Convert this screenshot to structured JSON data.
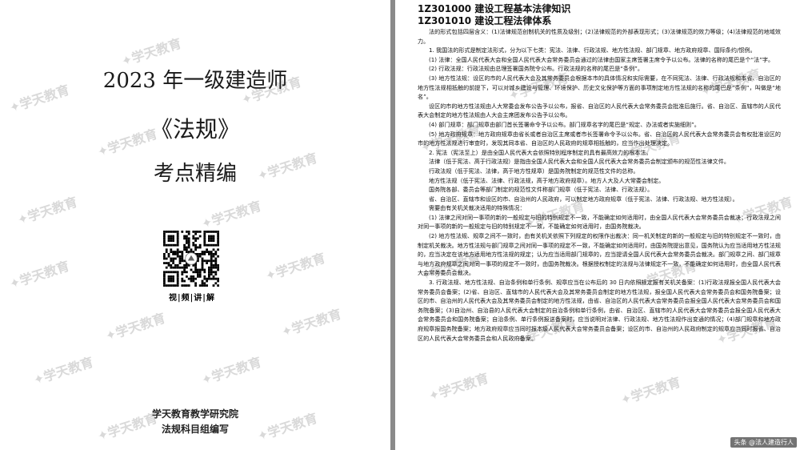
{
  "cover": {
    "title": "2023 年一级建造师",
    "subject": "《法规》",
    "subtitle": "考点精编",
    "video_label": "视|频|讲|解",
    "publisher": "学天教育教学研究院",
    "editor": "法规科目组编写"
  },
  "watermark": "学天教育",
  "corner_tag": "头条 @法人建造行人",
  "doc": {
    "chapter": "1Z301000 建设工程基本法律知识",
    "section": "1Z301010 建设工程法律体系",
    "paragraphs": [
      "法的形式包括四层含义：(1)法律规范创制机关的性质及级别；(2)法律规范的外部表现形式；(3)法律规范的效力等级；(4)法律规范的地域效力。",
      "1. 我国法的形式是制定法形式，分为以下七类：宪法、法律、行政法规、地方性法规、部门规章、地方政府规章、国际条约/惯例。",
      "(1) 法律：全国人民代表大会和全国人民代表大会常务委员会通过的法律由国家主席签署主席令予以公布。法律的名称的尾巴是个“法”字。",
      "(2) 行政法规：行政法规由总理签署国务院令公布。行政法规的名称的尾巴是“条例”。",
      "(3) 地方性法规：设区的市的人民代表大会及其常务委员会根据本市的具体情况和实际需要，在不同宪法、法律、行政法规和本省、自治区的地方性法规相抵触的前提下，可以对城乡建设与管理、环境保护、历史文化保护等方面的事项制定地方性法规的名称的尾巴是“条例”，叫做是“地名”。",
      "设区的市的地方性法规由人大常委会发布公告予以公布，报省、自治区的人民代表大会常务委员会批准后施行。省、自治区、直辖市的人民代表大会制定的地方性法规由人大会主席团发布公告予以公布。",
      "(4) 部门规章：部门规章由部门首长签署命令予以公布。部门规章名字的尾巴是“规定、办法或者实施细则”。",
      "(5) 地方政府规章：地方政府规章由省长或者自治区主席或者市长签署命令予以公布。省、自治区的人民代表大会常务委员会有权批准设区的市的地方性法规进行审查时，发现其同本省、自治区的人民政府的规章相抵触的，应当作出处理决定。",
      "2. 宪法（宪法至上）是由全国人民代表大会依照特别程序制定的具有最高效力的根本法。",
      "法律（低于宪法、高于行政法规）是指由全国人民代表大会和全国人民代表大会常务委员会制定颁布的规范性法律文件。",
      "行政法规（低于宪法、法律，高于地方性规章）是国务院制定的规范性文件的总称。",
      "地方性法规（低于宪法、法律、行政法规，高于地方政府规章）。地方人大及人大常委会制定。",
      "国务院各部、委员会等部门制定的规范性文件称部门规章（低于宪法、法律、行政法规）。",
      "省、自治区、直辖市和设区的市、自治州的人民政府，可以制定地方政府规章（低于宪法、法律、行政法规、地方性法规）。",
      "需要由有关机关裁决适用的特殊情况：",
      "(1) 法律之间对同一事项的新的一般规定与旧的特别规定不一致，不能确定如何适用时，由全国人民代表大会常务委员会裁决；行政法规之间对同一事项的新的一般规定与旧的特别规定不一致，不能确定如何适用时，由国务院裁决。",
      "(2) 地方性法规、规章之间不一致时，由有关机关依照下列规定的权限作出裁决：同一机关制定的新的一般规定与旧的特别规定不一致时，由制定机关裁决。地方性法规与部门规章之间对同一事项的规定不一致，不能确定如何适用时，由国务院提出意见，国务院认为应当适用地方性法规的，应当决定在该地方适用地方性法规的规定；认为应当适用部门规章的，应当提请全国人民代表大会常务委员会裁决。部门规章之间、部门规章与地方政府规章之间对同一事项的规定不一致时，由国务院裁决。根据授权制定的法规与法律规定不一致，不能确定如何适用时，由全国人民代表大会常务委员会裁决。",
      "3. 行政法规、地方性法规、自治条例和单行条例、规章应当在公布后的 30 日内依照规定报有关机关备案：(1)行政法规报全国人民代表大会常务委员会备案；(2)省、自治区、直辖市的人民代表大会及其常务委员会制定的地方性法规，报全国人民代表大会常务委员会和国务院备案；设区的市、自治州的人民代表大会及其常务委员会制定的地方性法规，由省、自治区的人民代表大会常务委员会报全国人民代表大会常务委员会和国务院备案；(3)自治州、自治县的人民代表大会制定的自治条例和单行条例，由省、自治区、直辖市的人民代表大会常务委员会报全国人民代表大会常务委员会和国务院备案；自治条例、单行条例报送备案时，应当说明对法律、行政法规、地方性法规作出变通的情况；(4)部门规章和地方政府规章报国务院备案；地方政府规章应当同时报本级人民代表大会常务委员会备案；设区的市、自治州的人民政府制定的规章应当同时报省、自治区的人民代表大会常务委员会和人民政府备案。"
    ]
  }
}
